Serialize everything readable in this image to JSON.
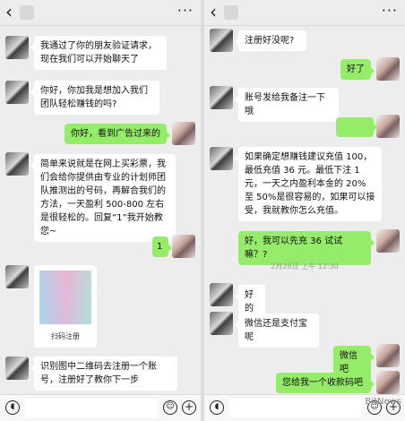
{
  "colors": {
    "background": "#ededed",
    "incoming_bubble": "#ffffff",
    "outgoing_bubble": "#95ec69",
    "timestamp": "#9a9a9a"
  },
  "icons": {
    "back": "‹",
    "more": "···",
    "voice": "voice-icon",
    "emoji": "emoji-icon",
    "plus": "plus-icon"
  },
  "left": {
    "messages": [
      {
        "from": "other",
        "text": "我通过了你的朋友验证请求，现在我们可以开始聊天了"
      },
      {
        "from": "other",
        "text": "你好，你加我是想加入我们团队轻松赚钱的吗?"
      },
      {
        "from": "me",
        "text": "你好，看到广告过来的"
      },
      {
        "from": "other",
        "text": "简单来说就是在网上买彩票，我们会给你提供由专业的计划师团队推测出的号码，再解合我们的方法，一天盈利 500-800 左右是很轻松的。回复“1”我开始教您~"
      },
      {
        "from": "me",
        "text": "1"
      },
      {
        "from": "other",
        "type": "image",
        "caption": "扫码注册"
      },
      {
        "from": "other",
        "text": "识别图中二维码去注册一个账号，注册好了教你下一步"
      }
    ]
  },
  "right": {
    "timestamp": "2月28日 上午 12:30",
    "messages": [
      {
        "from": "other",
        "text": "注册好没呢?"
      },
      {
        "from": "me",
        "text": "好了"
      },
      {
        "from": "other",
        "text": "账号发给我备注一下哦"
      },
      {
        "from": "me",
        "type": "hidden",
        "text": ""
      },
      {
        "from": "other",
        "text": "如果确定想赚钱建议充值 100，最低充值 36 元。最低下注 1 元，一天之内盈利本金的 20% 至 50%是很容易的，如果可以接受，我就教你怎么充值。"
      },
      {
        "from": "me",
        "text": "好，我可以先充 36 试试嘛？?"
      },
      {
        "from": "other",
        "text": "好的"
      },
      {
        "from": "other",
        "text": "微信还是支付宝呢"
      },
      {
        "from": "me",
        "text": "微信吧"
      },
      {
        "from": "me",
        "text": "您给我一个收款码吧"
      }
    ],
    "watermark": "BitNews"
  }
}
